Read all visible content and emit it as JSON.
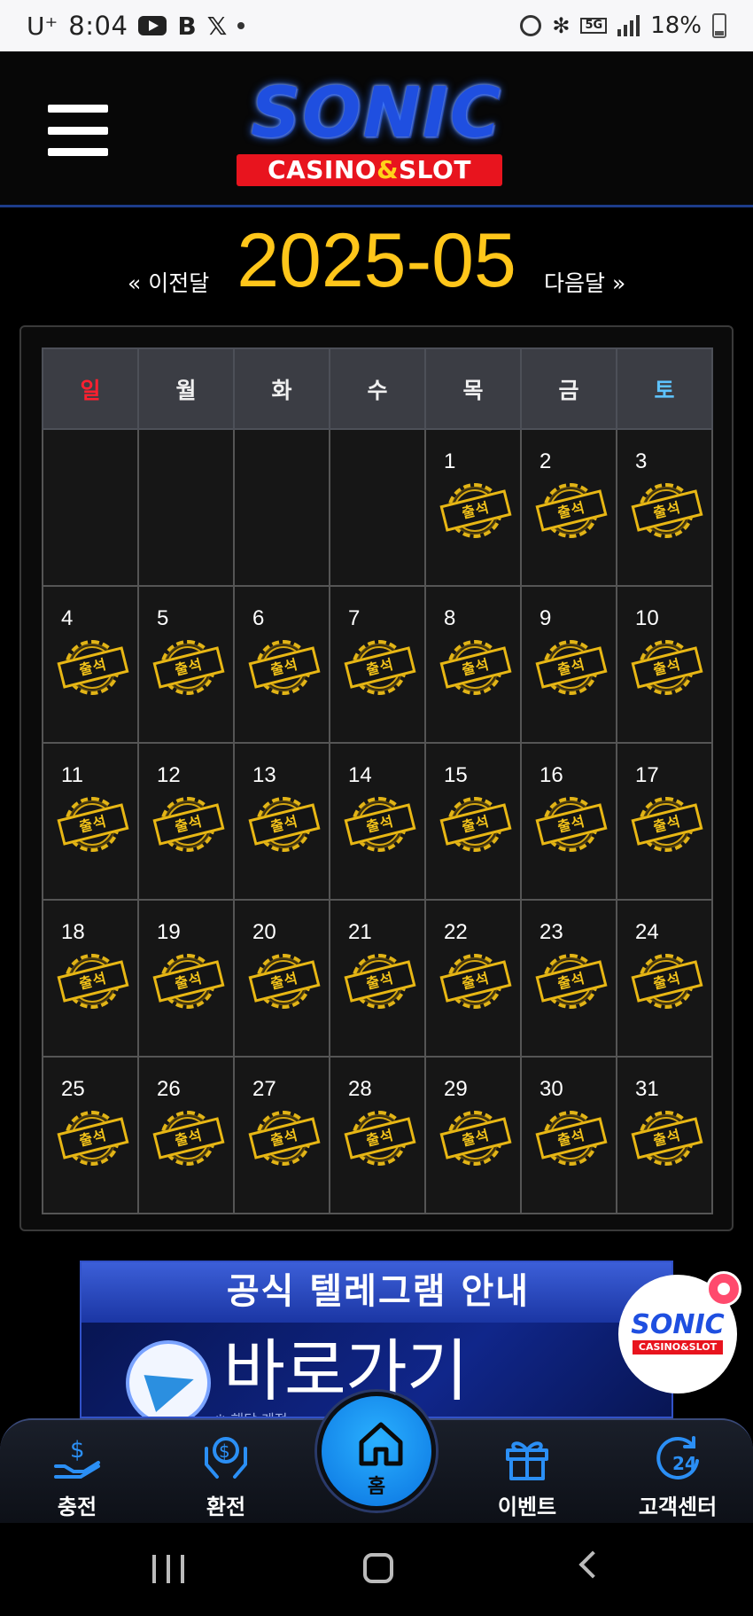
{
  "status_bar": {
    "carrier": "U⁺",
    "time": "8:04",
    "notification_icons": [
      "youtube-icon",
      "b-app-icon",
      "x-app-icon",
      "dot-icon"
    ],
    "network": "5G",
    "battery": "18%"
  },
  "header": {
    "logo_main": "SONIC",
    "logo_sub_left": "CASINO",
    "logo_sub_amp": "&",
    "logo_sub_right": "SLOT"
  },
  "month_nav": {
    "prev_label": "« 이전달",
    "next_label": "다음달 »",
    "title": "2025-05"
  },
  "calendar": {
    "weekdays": [
      "일",
      "월",
      "화",
      "수",
      "목",
      "금",
      "토"
    ],
    "stamp_label": "출석",
    "weeks": [
      [
        "",
        "",
        "",
        "",
        "1",
        "2",
        "3"
      ],
      [
        "4",
        "5",
        "6",
        "7",
        "8",
        "9",
        "10"
      ],
      [
        "11",
        "12",
        "13",
        "14",
        "15",
        "16",
        "17"
      ],
      [
        "18",
        "19",
        "20",
        "21",
        "22",
        "23",
        "24"
      ],
      [
        "25",
        "26",
        "27",
        "28",
        "29",
        "30",
        "31"
      ]
    ],
    "colors": {
      "sunday": "#ff2030",
      "saturday": "#5ec3ff",
      "stamp": "#e2b416",
      "title": "#ffc61a"
    }
  },
  "banner": {
    "title": "공식 텔레그램 안내",
    "cta": "바로가기 CLICK",
    "note": "※ 해당 계정"
  },
  "floating": {
    "logo_main": "SONIC",
    "logo_sub": "CASINO&SLOT"
  },
  "bottom_nav": {
    "items": [
      {
        "label": "충전",
        "icon": "deposit-icon"
      },
      {
        "label": "환전",
        "icon": "withdraw-icon"
      },
      {
        "label": "홈",
        "icon": "home-icon"
      },
      {
        "label": "이벤트",
        "icon": "gift-icon"
      },
      {
        "label": "고객센터",
        "icon": "support-24-icon"
      }
    ]
  }
}
